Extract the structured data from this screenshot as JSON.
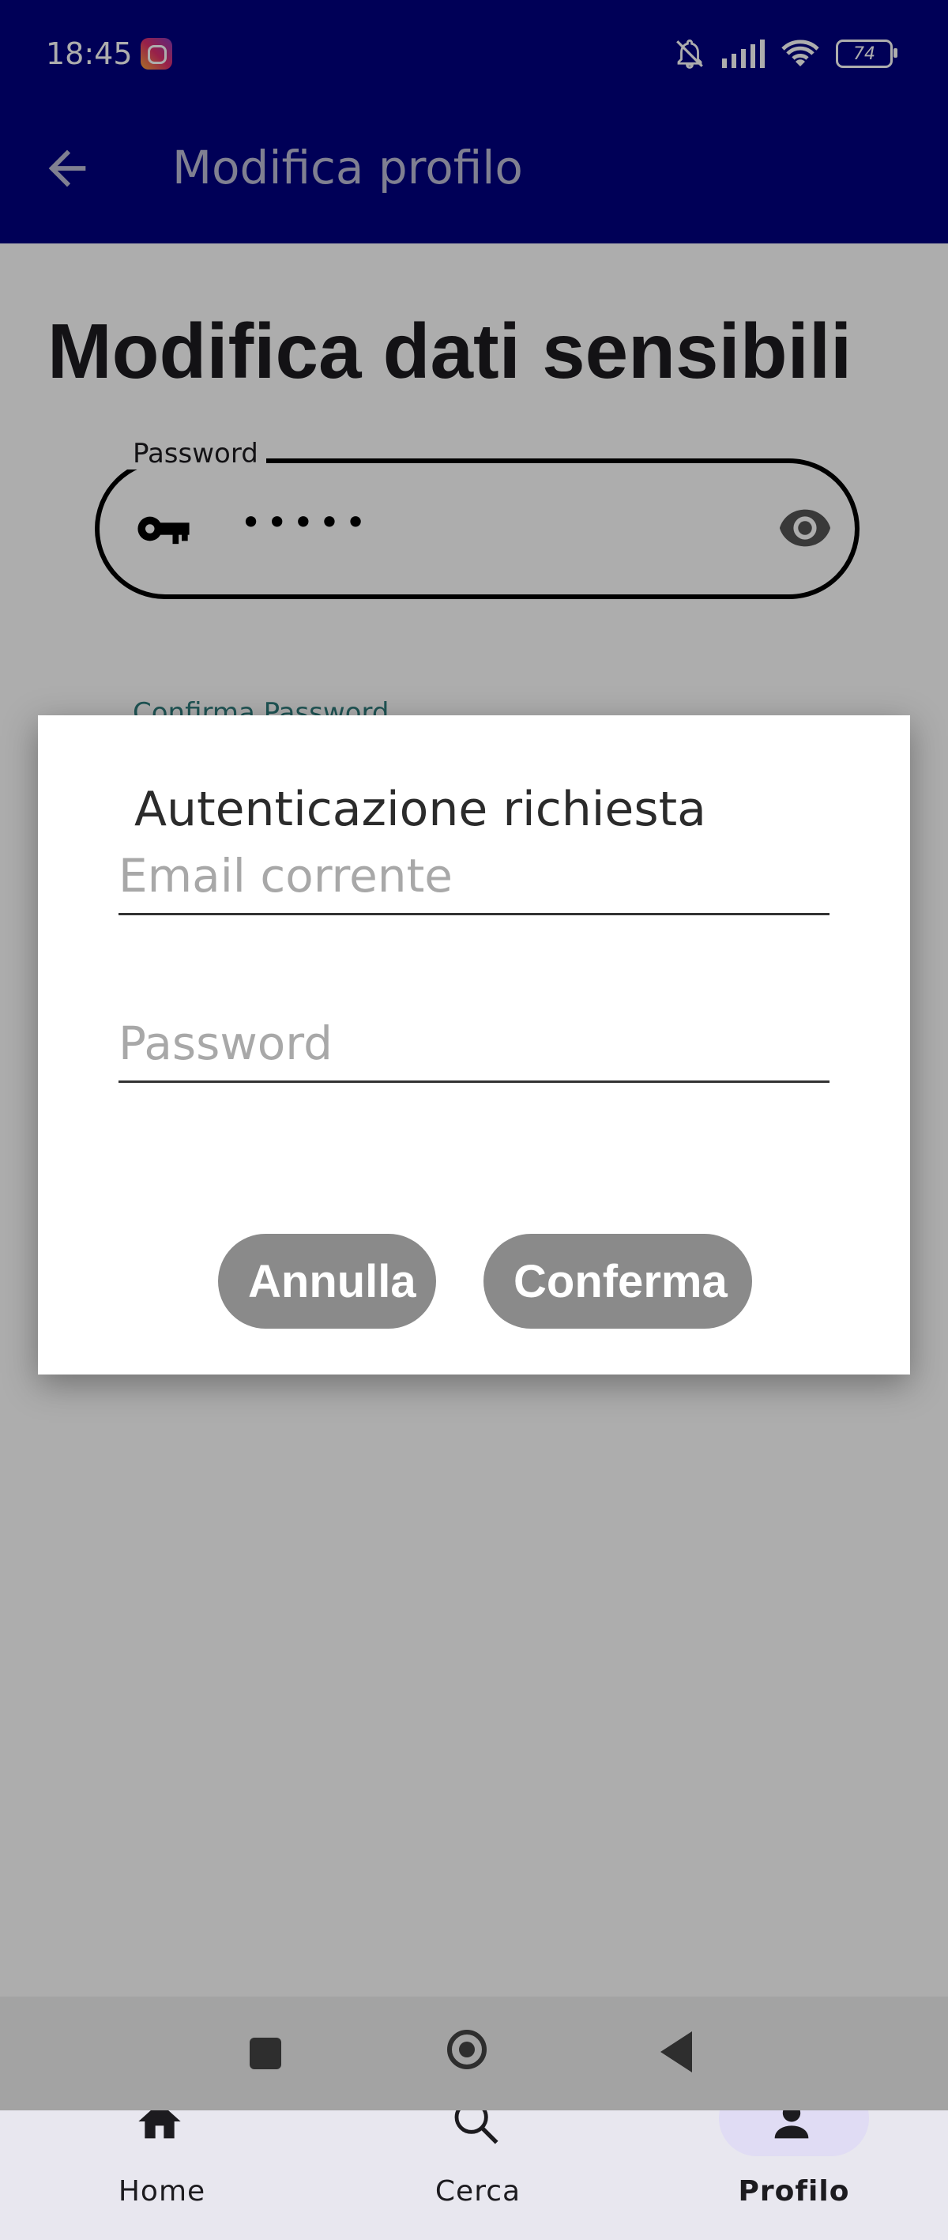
{
  "status_bar": {
    "time": "18:45",
    "battery": "74"
  },
  "app_bar": {
    "title": "Modifica profilo"
  },
  "page": {
    "heading": "Modifica dati sensibili",
    "password_field": {
      "label": "Password",
      "value": "•••••"
    },
    "confirm_password_field": {
      "label": "Confirma Password"
    }
  },
  "dialog": {
    "title": "Autenticazione richiesta",
    "email_placeholder": "Email corrente",
    "password_placeholder": "Password",
    "cancel_label": "Annulla",
    "confirm_label": "Conferma"
  },
  "bottom_nav": {
    "items": [
      {
        "label": "Home",
        "icon": "home-icon"
      },
      {
        "label": "Cerca",
        "icon": "search-icon"
      },
      {
        "label": "Profilo",
        "icon": "person-icon",
        "active": true
      }
    ]
  },
  "colors": {
    "app_bar": "#000080",
    "dialog_button": "#8a8a8a",
    "nav_active_pill": "#e0dcf4"
  }
}
